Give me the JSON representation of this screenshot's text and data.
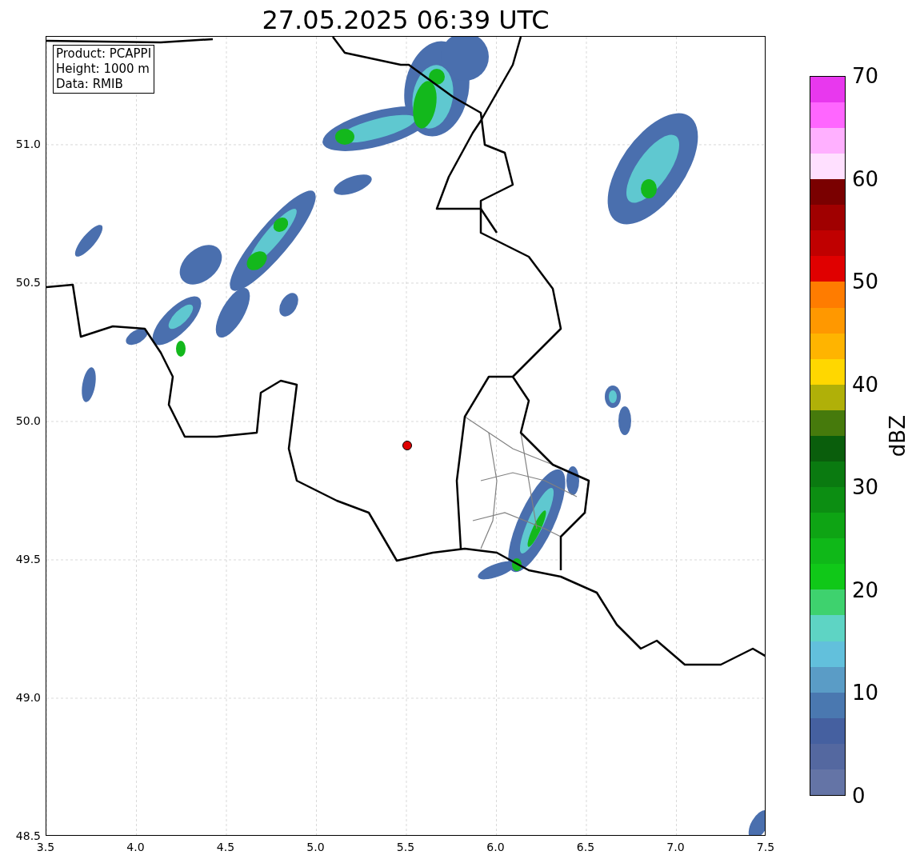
{
  "title": "27.05.2025 06:39 UTC",
  "info_box": [
    "Product: PCAPPI",
    "Height: 1000 m",
    "Data: RMIB"
  ],
  "map": {
    "x_ticks": [
      "3.5",
      "4.0",
      "4.5",
      "5.0",
      "5.5",
      "6.0",
      "6.5",
      "7.0",
      "7.5"
    ],
    "y_ticks": [
      "51.0",
      "50.5",
      "50.0",
      "49.5",
      "49.0",
      "48.5"
    ]
  },
  "colorbar": {
    "label": "dBZ",
    "ticks": [
      "70",
      "60",
      "50",
      "40",
      "30",
      "20",
      "10",
      "0"
    ],
    "bins": [
      {
        "color": "#6474a6"
      },
      {
        "color": "#5468a0"
      },
      {
        "color": "#4560a0"
      },
      {
        "color": "#4a78b0"
      },
      {
        "color": "#5a9cc6"
      },
      {
        "color": "#62c0dc"
      },
      {
        "color": "#5ed4c4"
      },
      {
        "color": "#3ed26e"
      },
      {
        "color": "#10c818"
      },
      {
        "color": "#0fb818"
      },
      {
        "color": "#0ea414"
      },
      {
        "color": "#0c8e12"
      },
      {
        "color": "#0a7a10"
      },
      {
        "color": "#0a5e0c"
      },
      {
        "color": "#467a0c"
      },
      {
        "color": "#b0b008"
      },
      {
        "color": "#ffd700"
      },
      {
        "color": "#ffb400"
      },
      {
        "color": "#ff9800"
      },
      {
        "color": "#ff7c00"
      },
      {
        "color": "#e00000"
      },
      {
        "color": "#c00000"
      },
      {
        "color": "#a00000"
      },
      {
        "color": "#7a0000"
      },
      {
        "color": "#ffe0ff"
      },
      {
        "color": "#ffb0ff"
      },
      {
        "color": "#ff66ff"
      },
      {
        "color": "#e838ee"
      }
    ]
  }
}
